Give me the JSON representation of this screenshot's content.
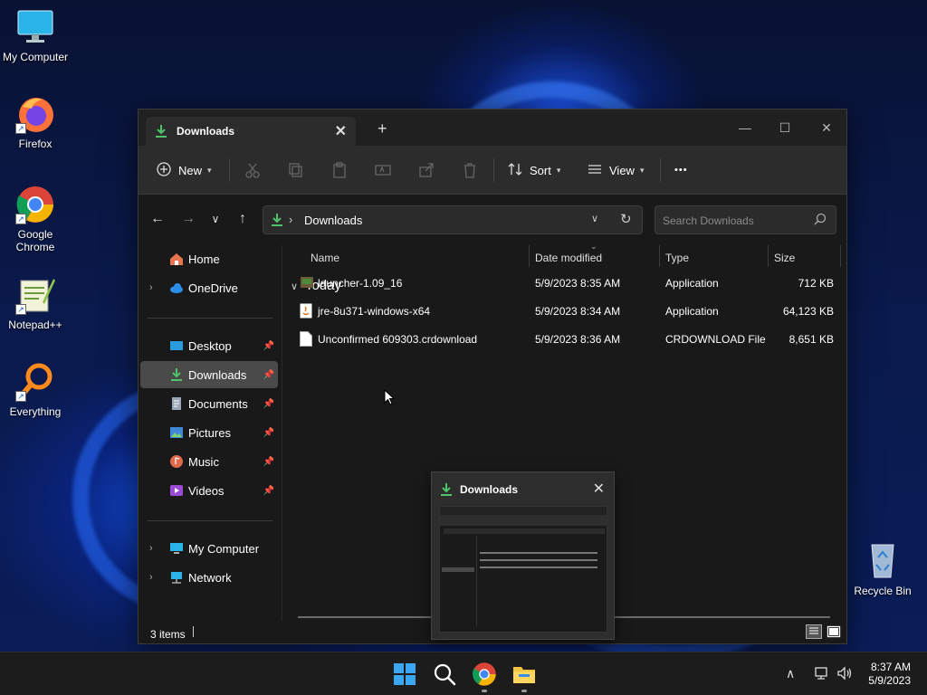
{
  "desktop": {
    "icons": [
      {
        "label": "My Computer"
      },
      {
        "label": "Firefox"
      },
      {
        "label": "Google Chrome"
      },
      {
        "label": "Notepad++"
      },
      {
        "label": "Everything"
      }
    ],
    "recycle_bin": "Recycle Bin"
  },
  "window": {
    "tab_title": "Downloads",
    "new_tab_symbol": "+",
    "controls": {
      "minimize": "—",
      "maximize": "☐",
      "close": "✕"
    }
  },
  "toolbar": {
    "new_label": "New",
    "sort_label": "Sort",
    "view_label": "View",
    "more_label": "•••"
  },
  "address": {
    "path_segment": "Downloads",
    "search_placeholder": "Search Downloads"
  },
  "nav": {
    "home": "Home",
    "onedrive": "OneDrive",
    "desktop": "Desktop",
    "downloads": "Downloads",
    "documents": "Documents",
    "pictures": "Pictures",
    "music": "Music",
    "videos": "Videos",
    "my_computer": "My Computer",
    "network": "Network"
  },
  "columns": {
    "name": "Name",
    "date_modified": "Date modified",
    "type": "Type",
    "size": "Size"
  },
  "group": "Today",
  "files": [
    {
      "name": "launcher-1.09_16",
      "date": "5/9/2023 8:35 AM",
      "type": "Application",
      "size": "712 KB"
    },
    {
      "name": "jre-8u371-windows-x64",
      "date": "5/9/2023 8:34 AM",
      "type": "Application",
      "size": "64,123 KB"
    },
    {
      "name": "Unconfirmed 609303.crdownload",
      "date": "5/9/2023 8:36 AM",
      "type": "CRDOWNLOAD File",
      "size": "8,651 KB"
    }
  ],
  "status": {
    "items": "3 items"
  },
  "preview": {
    "title": "Downloads"
  },
  "taskbar": {
    "time": "8:37 AM",
    "date": "5/9/2023"
  },
  "colors": {
    "accent_download": "#4fc36b",
    "folder_yellow": "#f5c542",
    "selection": "#4a4a4a"
  }
}
